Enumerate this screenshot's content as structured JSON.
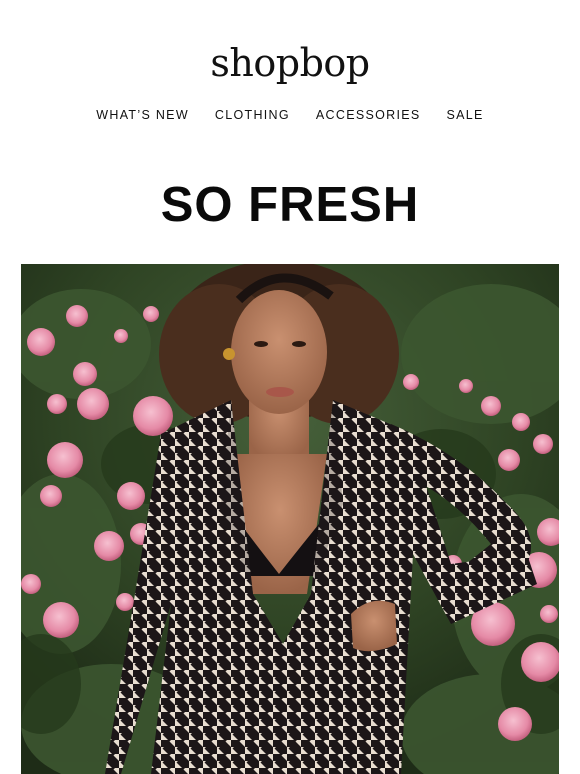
{
  "brand": {
    "logo_text": "shopbop"
  },
  "nav": {
    "items": [
      {
        "label": "WHAT’S NEW"
      },
      {
        "label": "CLOTHING"
      },
      {
        "label": "ACCESSORIES"
      },
      {
        "label": "SALE"
      }
    ]
  },
  "hero": {
    "headline": "SO FRESH",
    "image_subject": "model in houndstooth blazer among pink roses"
  },
  "colors": {
    "text": "#111111",
    "background": "#ffffff",
    "foliage": "#2f4424",
    "rose": "#e58aa6",
    "skin": "#b57a5a",
    "hair": "#3a2418",
    "blazer_dark": "#1c1618",
    "blazer_light": "#e8ddd0"
  }
}
